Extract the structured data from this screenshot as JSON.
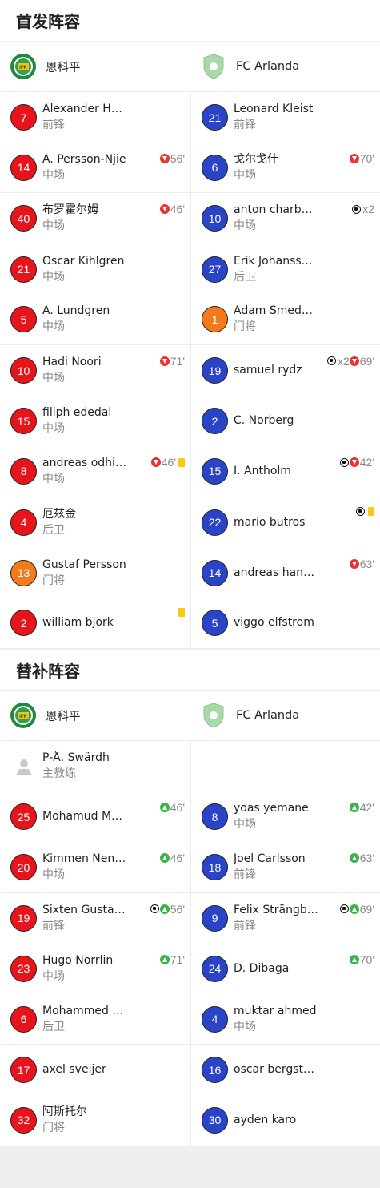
{
  "starting": {
    "title": "首发阵容",
    "home_team": "恩科平",
    "away_team": "FC Arlanda",
    "home": [
      {
        "number": "7",
        "name": "Alexander Hu…",
        "pos": "前锋",
        "color": "red",
        "events": []
      },
      {
        "number": "14",
        "name": "A. Persson-Njie",
        "pos": "中场",
        "color": "red",
        "events": [
          {
            "type": "sub-out",
            "text": "56'"
          }
        ]
      },
      {
        "number": "40",
        "name": "布罗霍尔姆",
        "pos": "中场",
        "color": "red",
        "events": [
          {
            "type": "sub-out",
            "text": "46'"
          }
        ]
      },
      {
        "number": "21",
        "name": "Oscar Kihlgren",
        "pos": "中场",
        "color": "red",
        "events": []
      },
      {
        "number": "5",
        "name": "A. Lundgren",
        "pos": "中场",
        "color": "red",
        "events": []
      },
      {
        "number": "10",
        "name": "Hadi Noori",
        "pos": "中场",
        "color": "red",
        "events": [
          {
            "type": "sub-out",
            "text": "71'"
          }
        ]
      },
      {
        "number": "15",
        "name": "filiph ededal",
        "pos": "中场",
        "color": "red",
        "events": []
      },
      {
        "number": "8",
        "name": "andreas odhi…",
        "pos": "中场",
        "color": "red",
        "events": [
          {
            "type": "sub-out",
            "text": "46'"
          },
          {
            "type": "yellow",
            "text": ""
          }
        ]
      },
      {
        "number": "4",
        "name": "厄兹金",
        "pos": "后卫",
        "color": "red",
        "events": []
      },
      {
        "number": "13",
        "name": "Gustaf Persson",
        "pos": "门将",
        "color": "orange",
        "events": []
      },
      {
        "number": "2",
        "name": "william bjork",
        "pos": "",
        "color": "red",
        "events": [
          {
            "type": "yellow",
            "text": ""
          }
        ]
      }
    ],
    "away": [
      {
        "number": "21",
        "name": "Leonard Kleist",
        "pos": "前锋",
        "color": "blue",
        "events": []
      },
      {
        "number": "6",
        "name": "戈尔戈什",
        "pos": "中场",
        "color": "blue",
        "events": [
          {
            "type": "sub-out",
            "text": "70'"
          }
        ]
      },
      {
        "number": "10",
        "name": "anton charbachi",
        "pos": "中场",
        "color": "blue",
        "events": [
          {
            "type": "goal",
            "text": "x2"
          }
        ]
      },
      {
        "number": "27",
        "name": "Erik Johanss…",
        "pos": "后卫",
        "color": "blue",
        "events": []
      },
      {
        "number": "1",
        "name": "Adam Smedb…",
        "pos": "门将",
        "color": "orange",
        "events": []
      },
      {
        "number": "19",
        "name": "samuel rydz",
        "pos": "",
        "color": "blue",
        "events": [
          {
            "type": "goal",
            "text": "x2"
          },
          {
            "type": "sub-out",
            "text": "69'"
          }
        ]
      },
      {
        "number": "2",
        "name": "C. Norberg",
        "pos": "",
        "color": "blue",
        "events": []
      },
      {
        "number": "15",
        "name": "I. Antholm",
        "pos": "",
        "color": "blue",
        "events": [
          {
            "type": "goal",
            "text": ""
          },
          {
            "type": "sub-out",
            "text": "42'"
          }
        ]
      },
      {
        "number": "22",
        "name": "mario butros",
        "pos": "",
        "color": "blue",
        "events": [
          {
            "type": "goal",
            "text": ""
          },
          {
            "type": "yellow",
            "text": ""
          }
        ]
      },
      {
        "number": "14",
        "name": "andreas hansen",
        "pos": "",
        "color": "blue",
        "events": [
          {
            "type": "sub-out",
            "text": "63'"
          }
        ]
      },
      {
        "number": "5",
        "name": "viggo elfstrom",
        "pos": "",
        "color": "blue",
        "events": []
      }
    ]
  },
  "subs": {
    "title": "替补阵容",
    "home_team": "恩科平",
    "away_team": "FC Arlanda",
    "coach": {
      "name": "P-Å. Swärdh",
      "role": "主教练"
    },
    "home": [
      {
        "number": "25",
        "name": "Mohamud Mu…",
        "pos": "",
        "color": "red",
        "events": [
          {
            "type": "sub-in",
            "text": "46'"
          }
        ]
      },
      {
        "number": "20",
        "name": "Kimmen Nen…",
        "pos": "中场",
        "color": "red",
        "events": [
          {
            "type": "sub-in",
            "text": "46'"
          }
        ]
      },
      {
        "number": "19",
        "name": "Sixten Gustaf…",
        "pos": "前锋",
        "color": "red",
        "events": [
          {
            "type": "goal",
            "text": ""
          },
          {
            "type": "sub-in",
            "text": "56'"
          }
        ]
      },
      {
        "number": "23",
        "name": "Hugo Norrlin",
        "pos": "中场",
        "color": "red",
        "events": [
          {
            "type": "sub-in",
            "text": "71'"
          }
        ]
      },
      {
        "number": "6",
        "name": "Mohammed …",
        "pos": "后卫",
        "color": "red",
        "events": []
      },
      {
        "number": "17",
        "name": "axel sveijer",
        "pos": "",
        "color": "red",
        "events": []
      },
      {
        "number": "32",
        "name": "阿斯托尔",
        "pos": "门将",
        "color": "red",
        "events": []
      }
    ],
    "away": [
      {
        "number": "8",
        "name": "yoas yemane",
        "pos": "中场",
        "color": "blue",
        "events": [
          {
            "type": "sub-in",
            "text": "42'"
          }
        ]
      },
      {
        "number": "18",
        "name": "Joel Carlsson",
        "pos": "前锋",
        "color": "blue",
        "events": [
          {
            "type": "sub-in",
            "text": "63'"
          }
        ]
      },
      {
        "number": "9",
        "name": "Felix Strängb…",
        "pos": "前锋",
        "color": "blue",
        "events": [
          {
            "type": "goal",
            "text": ""
          },
          {
            "type": "sub-in",
            "text": "69'"
          }
        ]
      },
      {
        "number": "24",
        "name": "D. Dibaga",
        "pos": "",
        "color": "blue",
        "events": [
          {
            "type": "sub-in",
            "text": "70'"
          }
        ]
      },
      {
        "number": "4",
        "name": "muktar ahmed",
        "pos": "中场",
        "color": "blue",
        "events": []
      },
      {
        "number": "16",
        "name": "oscar bergstedt",
        "pos": "",
        "color": "blue",
        "events": []
      },
      {
        "number": "30",
        "name": "ayden karo",
        "pos": "",
        "color": "blue",
        "events": []
      }
    ]
  }
}
